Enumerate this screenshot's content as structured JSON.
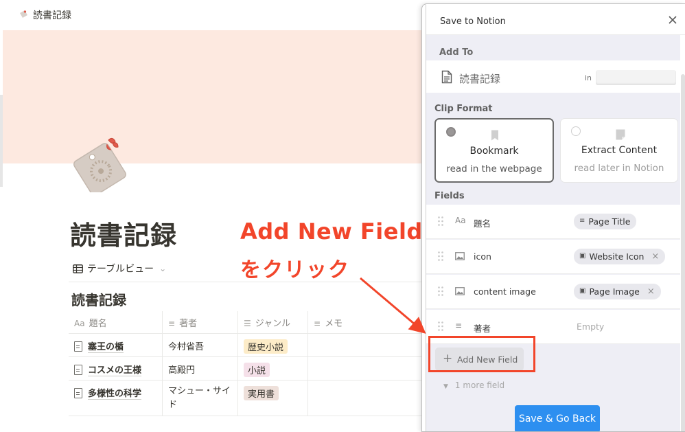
{
  "notion_page": {
    "breadcrumb": "読書記録",
    "title": "読書記録",
    "view_tab": "テーブルビュー",
    "database_title": "読書記録",
    "columns": [
      {
        "icon": "Aa",
        "label": "題名"
      },
      {
        "icon": "≡",
        "label": "著者"
      },
      {
        "icon": "☰",
        "label": "ジャンル"
      },
      {
        "icon": "≡",
        "label": "メモ"
      }
    ],
    "rows": [
      {
        "title": "塞王の楯",
        "author": "今村省吾",
        "genre": "歴史小説",
        "genre_color": "#fdecc8"
      },
      {
        "title": "コスメの王様",
        "author": "高殿円",
        "genre": "小説",
        "genre_color": "#f5e0e9"
      },
      {
        "title": "多様性の科学",
        "author": "マシュー・サイド",
        "genre": "実用書",
        "genre_color": "#eee0da"
      }
    ]
  },
  "annotation": {
    "title": "Add New Field",
    "subtitle": "をクリック",
    "color": "#f2452a"
  },
  "clipper": {
    "title": "Save to Notion",
    "add_to": {
      "label": "Add To",
      "database": "読書記録",
      "in_label": "in",
      "workspace": ""
    },
    "clip_format": {
      "label": "Clip Format",
      "options": [
        {
          "title": "Bookmark",
          "subtitle": "read in the webpage",
          "selected": true
        },
        {
          "title": "Extract Content",
          "subtitle": "read later in Notion",
          "selected": false
        }
      ]
    },
    "fields": {
      "label": "Fields",
      "items": [
        {
          "icon": "Aa",
          "name": "題名",
          "value": "Page Title",
          "value_icon": "text-icon",
          "removable": false
        },
        {
          "icon": "image-icon",
          "name": "icon",
          "value": "Website Icon",
          "value_icon": "image-icon",
          "removable": true
        },
        {
          "icon": "image-icon",
          "name": "content image",
          "value": "Page Image",
          "value_icon": "image-icon",
          "removable": true
        },
        {
          "icon": "text-icon",
          "name": "著者",
          "value": "Empty",
          "value_icon": "",
          "removable": false
        }
      ]
    },
    "add_field_label": "Add New Field",
    "more_fields": "1 more field",
    "save_label": "Save & Go Back",
    "save_color": "#2d8ff0"
  }
}
